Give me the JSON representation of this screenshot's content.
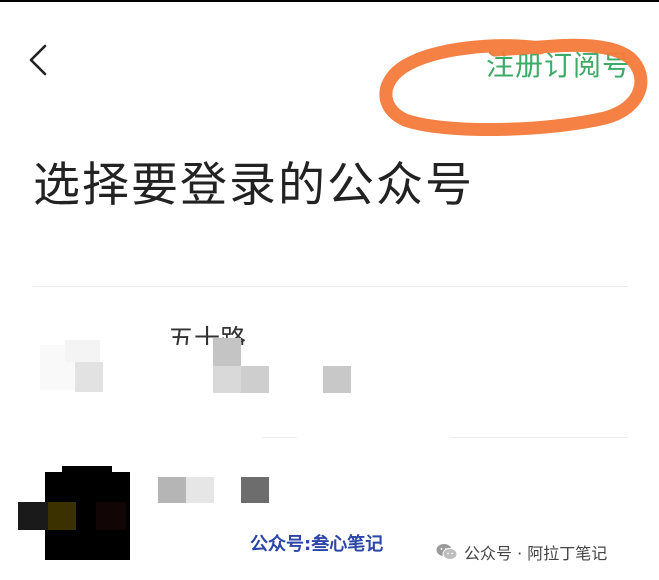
{
  "header": {
    "back_icon": "chevron-left-icon",
    "register_link_label": "注册订阅号",
    "annotation_color": "#f47a3a"
  },
  "page": {
    "title": "选择要登录的公众号",
    "accent_color": "#3cab67"
  },
  "accounts": [
    {
      "name_partial": "五十路",
      "obscured": true
    },
    {
      "name_partial": "",
      "obscured": true
    }
  ],
  "watermarks": {
    "left": "公众号:叁心笔记",
    "right_icon": "wechat-icon",
    "right": "公众号 · 阿拉丁笔记"
  }
}
